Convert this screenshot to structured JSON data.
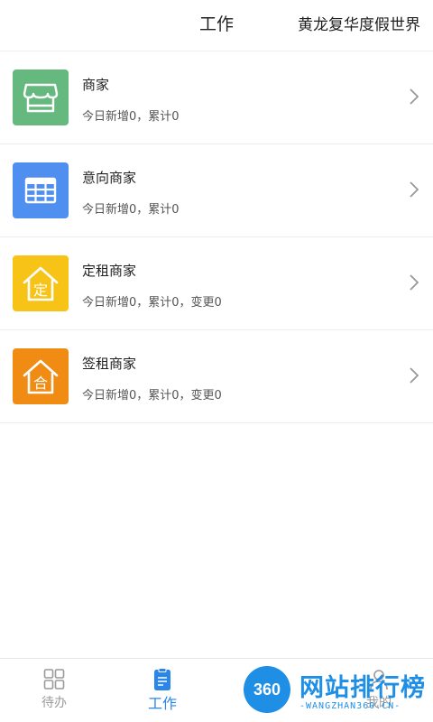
{
  "header": {
    "title": "工作",
    "org_name": "黄龙复华度假世界"
  },
  "items": [
    {
      "name": "商家",
      "subtitle": "今日新增0，累计0",
      "icon": "storefront-icon",
      "color": "#66b97e"
    },
    {
      "name": "意向商家",
      "subtitle": "今日新增0，累计0",
      "icon": "table-grid-icon",
      "color": "#4f8ff0"
    },
    {
      "name": "定租商家",
      "subtitle": "今日新增0，累计0，变更0",
      "icon": "house-ding-icon",
      "color": "#f6c316"
    },
    {
      "name": "签租商家",
      "subtitle": "今日新增0，累计0，变更0",
      "icon": "house-he-icon",
      "color": "#f08c13"
    }
  ],
  "icon_glyphs": {
    "ding": "定",
    "he": "合"
  },
  "tabs": [
    {
      "label": "待办",
      "icon": "grid-icon",
      "active": false
    },
    {
      "label": "工作",
      "icon": "clipboard-icon",
      "active": true
    },
    {
      "label": "我的",
      "icon": "user-icon",
      "active": false
    }
  ],
  "watermark": {
    "badge": "360",
    "text": "网站排行榜",
    "url": "-WANGZHAN360.CN-"
  },
  "colors": {
    "accent": "#2a86e8",
    "inactive": "#9a9a9a"
  }
}
